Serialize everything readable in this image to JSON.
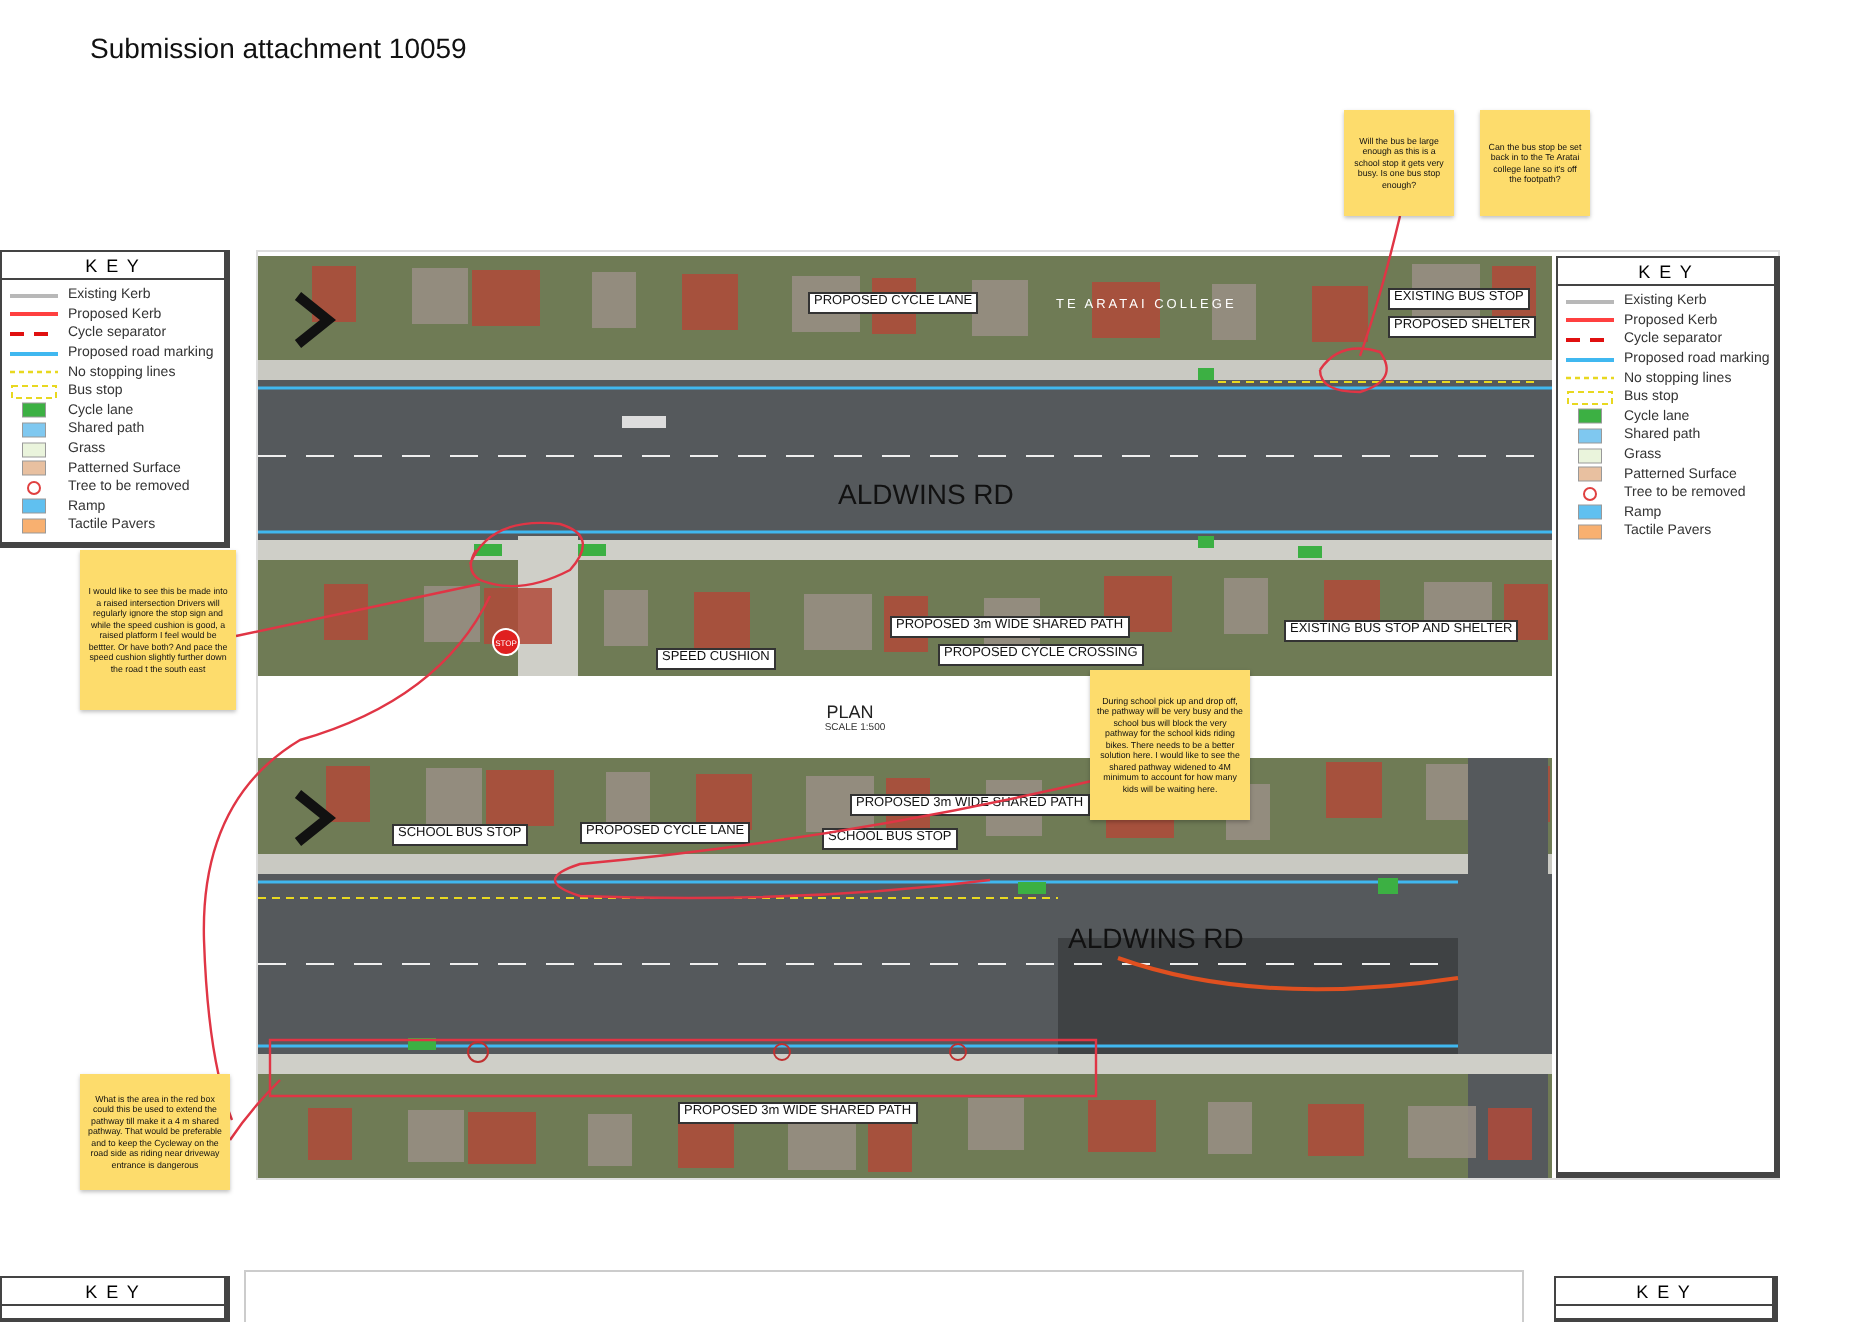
{
  "title": "Submission attachment 10059",
  "left_key": {
    "heading": "K E Y",
    "items": [
      {
        "label": "Existing Kerb",
        "kind": "line",
        "color": "#b8b8b8"
      },
      {
        "label": "Proposed Kerb",
        "kind": "line",
        "color": "#ff4040"
      },
      {
        "label": "Cycle separator",
        "kind": "dashed",
        "color": "#e01010"
      },
      {
        "label": "Proposed road marking",
        "kind": "line",
        "color": "#40b8f0"
      },
      {
        "label": "No stopping lines",
        "kind": "dotted",
        "color": "#e8d820"
      },
      {
        "label": "Bus stop",
        "kind": "dashbox",
        "color": "#e8d820"
      },
      {
        "label": "Cycle lane",
        "kind": "tile",
        "color": "#3cb043"
      },
      {
        "label": "Shared path",
        "kind": "tile",
        "color": "#7fc8f0"
      },
      {
        "label": "Grass",
        "kind": "tile",
        "color": "#eaf4dc"
      },
      {
        "label": "Patterned Surface",
        "kind": "tile",
        "color": "#e8c0a0"
      },
      {
        "label": "Tree to be removed",
        "kind": "circle",
        "color": "#e04040"
      },
      {
        "label": "Ramp",
        "kind": "tile",
        "color": "#60c0f0"
      },
      {
        "label": "Tactile Pavers",
        "kind": "tile",
        "color": "#f8b070"
      }
    ]
  },
  "sheet": {
    "top_map": {
      "labels": [
        {
          "text": "PROPOSED CYCLE LANE",
          "kind": "boxed"
        },
        {
          "text": "TE ARATAI COLLEGE",
          "kind": "plain"
        },
        {
          "text": "EXISTING BUS STOP",
          "kind": "boxed"
        },
        {
          "text": "PROPOSED SHELTER",
          "kind": "boxed"
        },
        {
          "text": "ALDWINS  RD",
          "kind": "road"
        },
        {
          "text": "PROPOSED 3m WIDE SHARED PATH",
          "kind": "boxed"
        },
        {
          "text": "PROPOSED CYCLE CROSSING",
          "kind": "boxed"
        },
        {
          "text": "SPEED CUSHION",
          "kind": "boxed"
        },
        {
          "text": "EXISTING BUS STOP AND SHELTER",
          "kind": "boxed"
        }
      ],
      "stop_sign": "STOP"
    },
    "plan": {
      "title": "PLAN",
      "scale": "SCALE 1:500"
    },
    "bottom_map": {
      "labels": [
        {
          "text": "SCHOOL BUS STOP",
          "kind": "boxed"
        },
        {
          "text": "PROPOSED CYCLE LANE",
          "kind": "boxed"
        },
        {
          "text": "PROPOSED 3m WIDE SHARED PATH",
          "kind": "boxed"
        },
        {
          "text": "SCHOOL BUS STOP",
          "kind": "boxed"
        },
        {
          "text": "ALDWINS  RD",
          "kind": "road"
        },
        {
          "text": "PROPOSED 3m WIDE SHARED PATH",
          "kind": "boxed"
        }
      ]
    },
    "key": {
      "heading": "K E Y",
      "items": [
        {
          "label": "Existing Kerb",
          "kind": "line",
          "color": "#b8b8b8"
        },
        {
          "label": "Proposed Kerb",
          "kind": "line",
          "color": "#ff4040"
        },
        {
          "label": "Cycle separator",
          "kind": "dashed",
          "color": "#e01010"
        },
        {
          "label": "Proposed road marking",
          "kind": "line",
          "color": "#40b8f0"
        },
        {
          "label": "No stopping lines",
          "kind": "dotted",
          "color": "#e8d820"
        },
        {
          "label": "Bus stop",
          "kind": "dashbox",
          "color": "#e8d820"
        },
        {
          "label": "Cycle lane",
          "kind": "tile",
          "color": "#3cb043"
        },
        {
          "label": "Shared path",
          "kind": "tile",
          "color": "#7fc8f0"
        },
        {
          "label": "Grass",
          "kind": "tile",
          "color": "#eaf4dc"
        },
        {
          "label": "Patterned Surface",
          "kind": "tile",
          "color": "#e8c0a0"
        },
        {
          "label": "Tree to be removed",
          "kind": "circle",
          "color": "#e04040"
        },
        {
          "label": "Ramp",
          "kind": "tile",
          "color": "#60c0f0"
        },
        {
          "label": "Tactile Pavers",
          "kind": "tile",
          "color": "#f8b070"
        }
      ]
    }
  },
  "notes": [
    {
      "text": "Will the bus be large enough as this is a school stop  it gets very busy. Is one bus stop enough?"
    },
    {
      "text": "Can the bus stop be set back in to the Te Aratai college lane so it's off the footpath?"
    },
    {
      "text": "I would like to see this be made into a raised intersection Drivers will regularly ignore the stop sign and while the speed cushion is good, a raised platform I feel would be bettter. Or have both? And pace the speed cushion slightly further down the road t the south east"
    },
    {
      "text": "During school pick up and drop off, the pathway will be very busy and the school bus will block the very pathway for the school kids riding bikes. There needs to be a better solution here. I would like to see the shared pathway widened to 4M minimum to account for how many kids will be waiting here."
    },
    {
      "text": "What is the area in the red box could this be used to extend the pathway till make it a 4 m shared pathway. That would be preferable and to keep the Cycleway on the road side as riding near driveway entrance is dangerous"
    }
  ],
  "next_sheet": {
    "left_key_heading": "K E Y",
    "right_key_heading": "K E Y"
  }
}
